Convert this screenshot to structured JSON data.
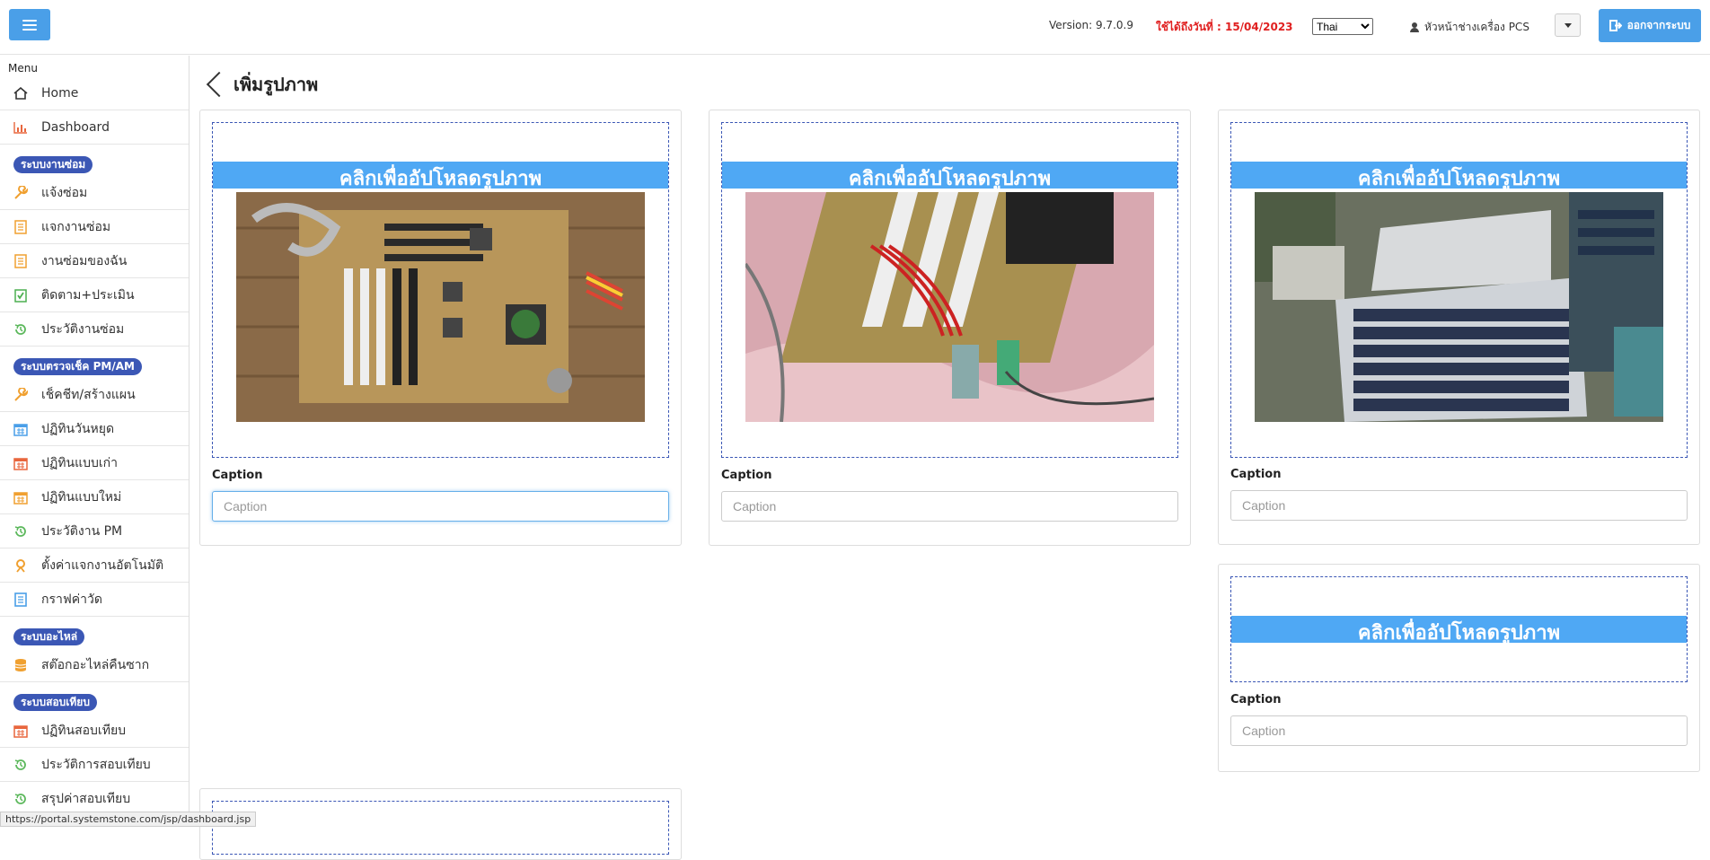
{
  "topbar": {
    "version": "Version: 9.7.0.9",
    "expiry": "ใช้ได้ถึงวันที่ : 15/04/2023",
    "language_selected": "Thai",
    "user": "หัวหน้าช่างเครื่อง PCS",
    "logout_label": "ออกจากระบบ"
  },
  "sidebar": {
    "menu_title": "Menu",
    "top_items": [
      {
        "label": "Home",
        "icon": "home-icon"
      },
      {
        "label": "Dashboard",
        "icon": "bar-chart-icon"
      }
    ],
    "sections": [
      {
        "title": "ระบบงานซ่อม",
        "items": [
          {
            "label": "แจ้งซ่อม",
            "icon": "wrench-icon"
          },
          {
            "label": "แจกงานซ่อม",
            "icon": "document-icon"
          },
          {
            "label": "งานซ่อมของฉัน",
            "icon": "document-icon"
          },
          {
            "label": "ติดตาม+ประเมิน",
            "icon": "checklist-icon"
          },
          {
            "label": "ประวัติงานซ่อม",
            "icon": "history-icon"
          }
        ]
      },
      {
        "title": "ระบบตรวจเช็ค PM/AM",
        "items": [
          {
            "label": "เช็คชีท/สร้างแผน",
            "icon": "wrench-icon"
          },
          {
            "label": "ปฏิทินวันหยุด",
            "icon": "calendar-icon"
          },
          {
            "label": "ปฏิทินแบบเก่า",
            "icon": "calendar-icon"
          },
          {
            "label": "ปฏิทินแบบใหม่",
            "icon": "calendar-icon"
          },
          {
            "label": "ประวัติงาน PM",
            "icon": "history-icon"
          },
          {
            "label": "ตั้งค่าแจกงานอัตโนมัติ",
            "icon": "user-pin-icon"
          },
          {
            "label": "กราฟค่าวัด",
            "icon": "list-icon"
          }
        ]
      },
      {
        "title": "ระบบอะไหล่",
        "items": [
          {
            "label": "สต๊อกอะไหล่คืนซาก",
            "icon": "database-icon"
          }
        ]
      },
      {
        "title": "ระบบสอบเทียบ",
        "items": [
          {
            "label": "ปฏิทินสอบเทียบ",
            "icon": "calendar-icon"
          },
          {
            "label": "ประวัติการสอบเทียบ",
            "icon": "history-icon"
          },
          {
            "label": "สรุปค่าสอบเทียบ",
            "icon": "history-icon"
          }
        ]
      }
    ],
    "status_url": "https://portal.systemstone.com/jsp/dashboard.jsp"
  },
  "main": {
    "page_title": "เพิ่มรูปภาพ",
    "upload_text": "คลิกเพื่ออัปโหลดรูปภาพ",
    "caption_label": "Caption",
    "caption_placeholder": "Caption",
    "cards": [
      {
        "image": "motherboard-photo"
      },
      {
        "image": "pci-slots-photo"
      },
      {
        "image": "solar-rooftop-aerial-photo"
      },
      {
        "image": ""
      }
    ]
  },
  "colors": {
    "accent": "#4a9fe8",
    "upload_band": "#4fa8f4",
    "section_pill": "#3b57b5",
    "expiry": "#e02020"
  }
}
